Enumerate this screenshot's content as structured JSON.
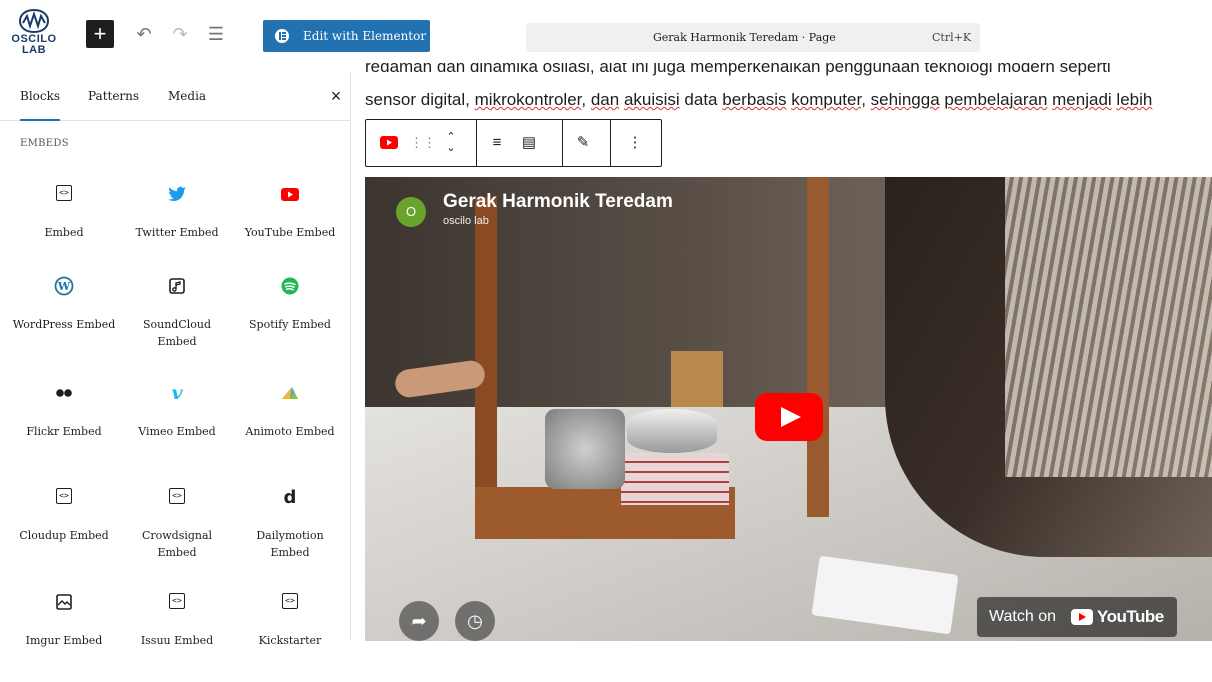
{
  "toolbar": {
    "logo_text_1": "OSCILO",
    "logo_text_2": "LAB",
    "add_label": "+",
    "undo_icon": "undo-icon",
    "redo_icon": "redo-icon",
    "list_view_icon": "list-view-icon",
    "elementor_label": "Edit with Elementor",
    "command_title": "Gerak Harmonik Teredam · Page",
    "command_shortcut": "Ctrl+K"
  },
  "sidebar": {
    "tabs": [
      "Blocks",
      "Patterns",
      "Media"
    ],
    "active_tab": "Blocks",
    "close_label": "×",
    "section_title": "EMBEDS",
    "items": [
      {
        "label": "Embed",
        "icon": "embed-icon"
      },
      {
        "label": "Twitter Embed",
        "icon": "twitter-icon"
      },
      {
        "label": "YouTube Embed",
        "icon": "youtube-icon"
      },
      {
        "label": "WordPress Embed",
        "icon": "wordpress-icon"
      },
      {
        "label": "SoundCloud Embed",
        "icon": "soundcloud-icon"
      },
      {
        "label": "Spotify Embed",
        "icon": "spotify-icon"
      },
      {
        "label": "Flickr Embed",
        "icon": "flickr-icon"
      },
      {
        "label": "Vimeo Embed",
        "icon": "vimeo-icon"
      },
      {
        "label": "Animoto Embed",
        "icon": "animoto-icon"
      },
      {
        "label": "Cloudup Embed",
        "icon": "embed-icon"
      },
      {
        "label": "Crowdsignal Embed",
        "icon": "embed-icon"
      },
      {
        "label": "Dailymotion Embed",
        "icon": "dailymotion-icon"
      },
      {
        "label": "Imgur Embed",
        "icon": "imgur-icon"
      },
      {
        "label": "Issuu Embed",
        "icon": "embed-icon"
      },
      {
        "label": "Kickstarter",
        "icon": "embed-icon"
      }
    ]
  },
  "content": {
    "paragraph_line_1": "redaman dan dinamika osilasi, alat ini juga memperkenalkan penggunaan teknologi modern seperti",
    "paragraph_line_2_parts": [
      "sensor digital, ",
      "mikrokontroler",
      ", ",
      "dan",
      " ",
      "akuisisi",
      " data ",
      "berbasis",
      " ",
      "komputer",
      ", ",
      "sehingga",
      " ",
      "pembelajaran",
      " ",
      "menjadi",
      " ",
      "lebih"
    ],
    "video": {
      "avatar_letter": "O",
      "title": "Gerak Harmonik Teredam",
      "channel": "oscilo lab",
      "watch_on": "Watch on",
      "youtube": "YouTube"
    }
  },
  "colors": {
    "accent": "#2271b1",
    "youtube_red": "#ff0000",
    "twitter_blue": "#1d9bf0",
    "spotify_green": "#1db954",
    "wordpress_blue": "#21759b",
    "vimeo_blue": "#1ab7ea"
  }
}
